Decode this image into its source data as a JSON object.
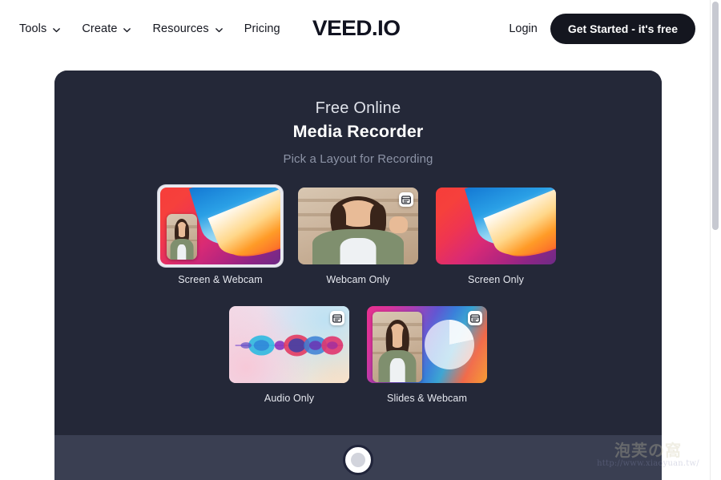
{
  "header": {
    "brand": "VEED.IO",
    "nav": [
      {
        "label": "Tools",
        "has_chevron": true,
        "icon": "chevron-down-icon"
      },
      {
        "label": "Create",
        "has_chevron": true,
        "icon": "chevron-down-icon"
      },
      {
        "label": "Resources",
        "has_chevron": true,
        "icon": "chevron-down-icon"
      },
      {
        "label": "Pricing",
        "has_chevron": false,
        "icon": ""
      }
    ],
    "login_label": "Login",
    "cta_label": "Get Started - it's free"
  },
  "recorder": {
    "heading_line1": "Free Online",
    "heading_line2": "Media Recorder",
    "subheading": "Pick a Layout for Recording",
    "layouts_row1": [
      {
        "label": "Screen & Webcam",
        "selected": true,
        "badge_icon": ""
      },
      {
        "label": "Webcam Only",
        "selected": false,
        "badge_icon": "browser-window-icon"
      },
      {
        "label": "Screen Only",
        "selected": false,
        "badge_icon": ""
      }
    ],
    "layouts_row2": [
      {
        "label": "Audio Only",
        "selected": false,
        "badge_icon": "browser-window-icon"
      },
      {
        "label": "Slides & Webcam",
        "selected": false,
        "badge_icon": "browser-window-icon"
      }
    ],
    "record_button_name": "record-button"
  },
  "watermark": {
    "cjk": "泡芙の窩",
    "url": "http://www.xiaoyuan.tw/"
  },
  "colors": {
    "panel_bg": "#242838",
    "control_bar_bg": "#3a3f52",
    "cta_bg": "#14161f",
    "heading_white": "#ffffff",
    "sub_gray": "#8c93a6",
    "selection_ring": "#e9eaf0"
  }
}
